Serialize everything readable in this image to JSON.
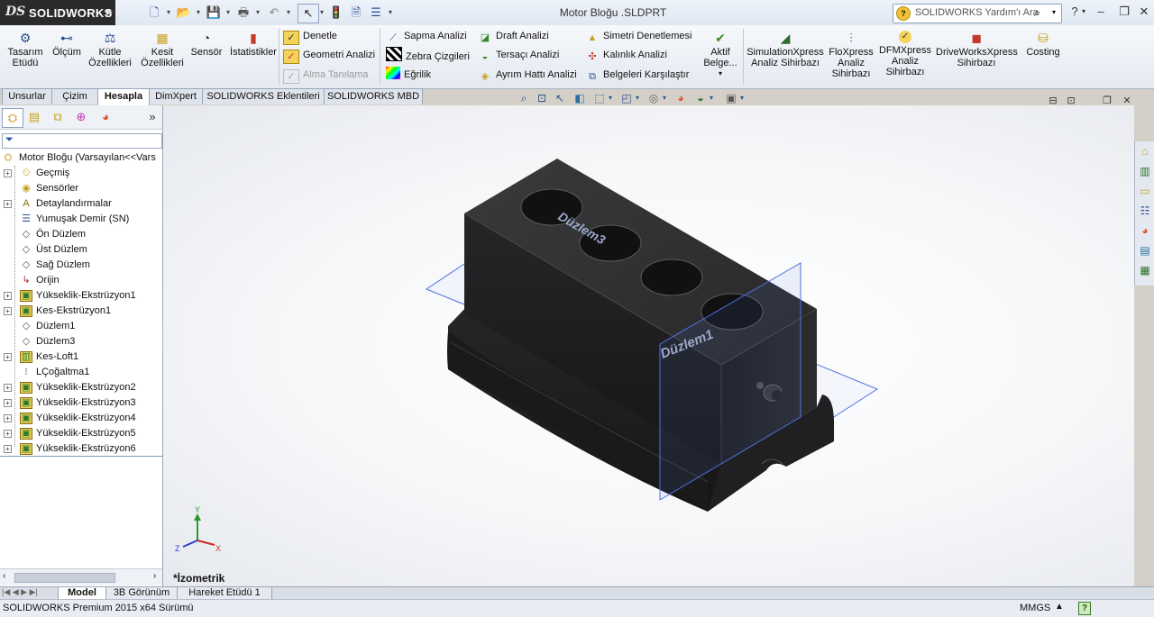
{
  "app": {
    "brand": "SOLIDWORKS",
    "ds_mark": "DS",
    "title": "Motor Bloğu .SLDPRT"
  },
  "search": {
    "placeholder": "SOLIDWORKS Yardım'ı Ara",
    "help_glyph": "?"
  },
  "command_manager": {
    "big_buttons": [
      {
        "label": "Tasarım Etüdü",
        "icon": "design-study-icon"
      },
      {
        "label": "Ölçüm",
        "icon": "measure-icon"
      },
      {
        "label": "Kütle Özellikleri",
        "icon": "mass-properties-icon"
      },
      {
        "label": "Kesit Özellikleri",
        "icon": "section-properties-icon"
      },
      {
        "label": "Sensör",
        "icon": "sensor-icon"
      },
      {
        "label": "İstatistikler",
        "icon": "statistics-icon"
      }
    ],
    "group1": [
      {
        "label": "Denetle",
        "icon": "check-icon"
      },
      {
        "label": "Geometri Analizi",
        "icon": "geometry-analysis-icon"
      },
      {
        "label": "Alma Tanılama",
        "icon": "import-diagnostics-icon",
        "disabled": true
      }
    ],
    "group2": [
      {
        "label": "Sapma Analizi",
        "icon": "deviation-analysis-icon"
      },
      {
        "label": "Zebra Çizgileri",
        "icon": "zebra-stripes-icon"
      },
      {
        "label": "Eğrilik",
        "icon": "curvature-icon"
      }
    ],
    "group3": [
      {
        "label": "Draft Analizi",
        "icon": "draft-analysis-icon"
      },
      {
        "label": "Tersaçı Analizi",
        "icon": "undercut-analysis-icon"
      },
      {
        "label": "Ayrım Hattı Analizi",
        "icon": "parting-line-icon"
      }
    ],
    "group4": [
      {
        "label": "Simetri Denetlemesi",
        "icon": "symmetry-check-icon"
      },
      {
        "label": "Kalınlık Analizi",
        "icon": "thickness-analysis-icon"
      },
      {
        "label": "Belgeleri Karşılaştır",
        "icon": "compare-documents-icon"
      }
    ],
    "active_doc": {
      "label": "Aktif Belge...",
      "icon": "active-document-icon"
    },
    "xpress": [
      {
        "label": "SimulationXpress Analiz Sihirbazı",
        "icon": "simulationxpress-icon"
      },
      {
        "label": "FloXpress Analiz Sihirbazı",
        "icon": "floxpress-icon"
      },
      {
        "label": "DFMXpress Analiz Sihirbazı",
        "icon": "dfmxpress-icon"
      },
      {
        "label": "DriveWorksXpress Sihirbazı",
        "icon": "driveworksxpress-icon"
      },
      {
        "label": "Costing",
        "icon": "costing-icon"
      }
    ]
  },
  "tabs": [
    "Unsurlar",
    "Çizim",
    "Hesapla",
    "DimXpert",
    "SOLIDWORKS Eklentileri",
    "SOLIDWORKS MBD"
  ],
  "active_tab": "Hesapla",
  "feature_tree": {
    "root": "Motor Bloğu  (Varsayılan<<Vars",
    "items": [
      {
        "label": "Geçmiş",
        "icon": "history-icon",
        "expand": true
      },
      {
        "label": "Sensörler",
        "icon": "sensors-icon",
        "expand": false
      },
      {
        "label": "Detaylandırmalar",
        "icon": "annotations-icon",
        "expand": true
      },
      {
        "label": "Yumuşak Demir (SN)",
        "icon": "material-icon",
        "expand": false
      },
      {
        "label": "Ön Düzlem",
        "icon": "plane-icon",
        "expand": false
      },
      {
        "label": "Üst Düzlem",
        "icon": "plane-icon",
        "expand": false
      },
      {
        "label": "Sağ Düzlem",
        "icon": "plane-icon",
        "expand": false
      },
      {
        "label": "Orijin",
        "icon": "origin-icon",
        "expand": false
      },
      {
        "label": "Yükseklik-Ekstrüzyon1",
        "icon": "extrude-icon",
        "expand": true
      },
      {
        "label": "Kes-Ekstrüzyon1",
        "icon": "cut-extrude-icon",
        "expand": true
      },
      {
        "label": "Düzlem1",
        "icon": "plane-icon",
        "expand": false
      },
      {
        "label": "Düzlem3",
        "icon": "plane-icon",
        "expand": false
      },
      {
        "label": "Kes-Loft1",
        "icon": "cut-loft-icon",
        "expand": true
      },
      {
        "label": "LÇoğaltma1",
        "icon": "linear-pattern-icon",
        "expand": false
      },
      {
        "label": "Yükseklik-Ekstrüzyon2",
        "icon": "extrude-icon",
        "expand": true
      },
      {
        "label": "Yükseklik-Ekstrüzyon3",
        "icon": "extrude-icon",
        "expand": true
      },
      {
        "label": "Yükseklik-Ekstrüzyon4",
        "icon": "extrude-icon",
        "expand": true
      },
      {
        "label": "Yükseklik-Ekstrüzyon5",
        "icon": "extrude-icon",
        "expand": true
      },
      {
        "label": "Yükseklik-Ekstrüzyon6",
        "icon": "extrude-icon",
        "expand": true
      }
    ]
  },
  "viewport": {
    "view_label": "*İzometrik",
    "plane_labels": {
      "top": "Düzlem3",
      "side": "Düzlem1"
    },
    "triad": {
      "x": "X",
      "y": "Y",
      "z": "Z"
    }
  },
  "bottom_tabs": [
    "Model",
    "3B Görünüm",
    "Hareket Etüdü 1"
  ],
  "active_bottom_tab": "Model",
  "status": {
    "text": "SOLIDWORKS Premium 2015 x64 Sürümü",
    "units": "MMGS",
    "units_arrow": "▲",
    "help": "?"
  },
  "colors": {
    "body": "#1e1e1f",
    "plane": "#4f72e0",
    "accent": "#2a4f8f"
  }
}
